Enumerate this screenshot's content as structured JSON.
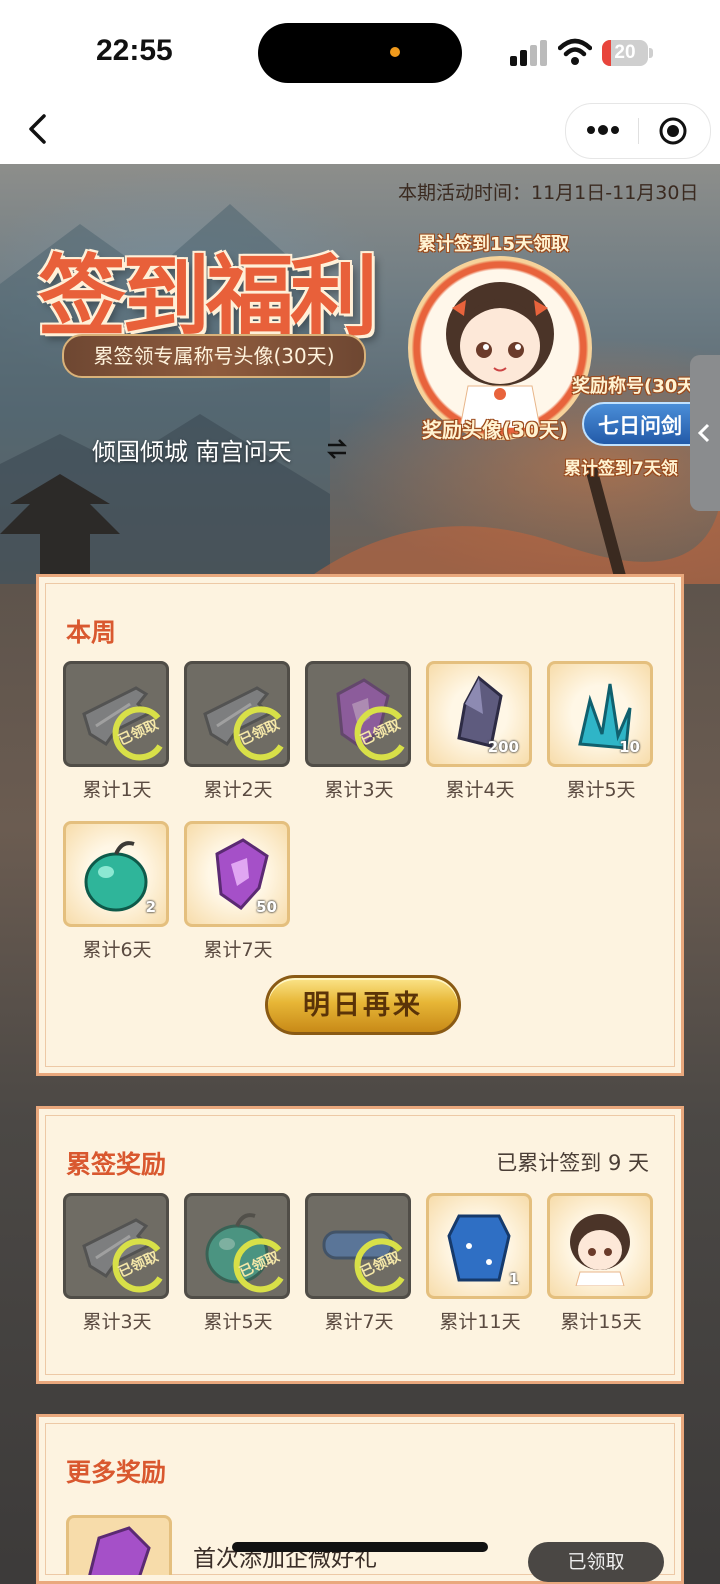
{
  "status_bar": {
    "time": "22:55",
    "battery": "20",
    "battery_level": 0.2
  },
  "banner": {
    "period": "本期活动时间：11月1日-11月30日",
    "title": "签到福利",
    "subtitle": "累签领专属称号头像(30天)",
    "rank_text": "倾国倾城 南宫问天",
    "cumulative_15": "累计签到15天领取",
    "avatar_reward_label": "奖励头像(30天)",
    "title_reward_label": "奖励称号(30天",
    "seven_day_badge": "七日问剑",
    "cumulative_7": "累计签到7天领"
  },
  "weekly": {
    "title": "本周",
    "button": "明日再来",
    "claimed_text": "已领取",
    "items": [
      {
        "label": "累计1天",
        "state": "claimed",
        "icon": "broken-sword-icon",
        "qty": ""
      },
      {
        "label": "累计2天",
        "state": "claimed",
        "icon": "broken-sword-icon",
        "qty": ""
      },
      {
        "label": "累计3天",
        "state": "claimed",
        "icon": "purple-gem-icon",
        "qty": ""
      },
      {
        "label": "累计4天",
        "state": "available",
        "icon": "dark-crystal-icon",
        "qty": "200"
      },
      {
        "label": "累计5天",
        "state": "available",
        "icon": "blue-crystal-icon",
        "qty": "10"
      },
      {
        "label": "累计6天",
        "state": "available",
        "icon": "green-fruit-icon",
        "qty": "2"
      },
      {
        "label": "累计7天",
        "state": "available",
        "icon": "purple-gem-icon",
        "qty": "50"
      }
    ]
  },
  "cumulative": {
    "title": "累签奖励",
    "progress": "已累计签到 9 天",
    "items": [
      {
        "label": "累计3天",
        "state": "claimed",
        "icon": "broken-sword-icon",
        "qty": ""
      },
      {
        "label": "累计5天",
        "state": "claimed",
        "icon": "green-fruit-icon",
        "qty": ""
      },
      {
        "label": "累计7天",
        "state": "claimed",
        "icon": "title-plate-icon",
        "qty": ""
      },
      {
        "label": "累计11天",
        "state": "available",
        "icon": "blue-cloak-icon",
        "qty": "1"
      },
      {
        "label": "累计15天",
        "state": "available",
        "icon": "avatar-girl-icon",
        "qty": ""
      }
    ]
  },
  "more": {
    "title": "更多奖励",
    "first_item_text": "首次添加企微好礼",
    "first_item_button": "已领取"
  },
  "colors": {
    "accent": "#d9582f",
    "card_bg": "#fdf3e0",
    "card_border": "#e9a87d",
    "gold": "#e7b636"
  }
}
